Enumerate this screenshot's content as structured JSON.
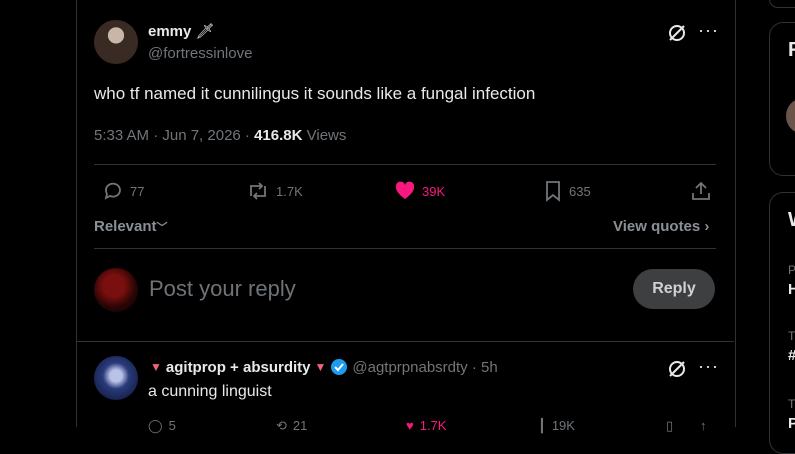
{
  "tweet": {
    "display_name": "emmy",
    "handle": "@fortressinlove",
    "text": "who tf named it cunnilingus it sounds like a fungal infection",
    "time": "5:33 AM · Jun 7, 2026 · ",
    "views_count": "416.8K",
    "views_label": " Views",
    "replies": "77",
    "reposts": "1.7K",
    "likes": "39K",
    "bookmarks": "635"
  },
  "sort": {
    "label": "Relevant",
    "view_quotes": "View quotes"
  },
  "composer": {
    "placeholder": "Post your reply",
    "button": "Reply"
  },
  "reply": {
    "display_name": "agitprop + absurdity",
    "handle": "@agtprpnabsrdty · 5h",
    "text": "a cunning linguist",
    "replies": "5",
    "reposts": "21",
    "likes": "1.7K",
    "views": "19K"
  },
  "sidebar": {
    "card1_initial": "R",
    "card2_initial": "W",
    "rows": [
      "P",
      "H",
      "T",
      "#",
      "T",
      "P"
    ]
  },
  "colors": {
    "like": "#f91880",
    "verified": "#1d9bf0",
    "border": "#2f3336",
    "muted": "#71767b"
  }
}
